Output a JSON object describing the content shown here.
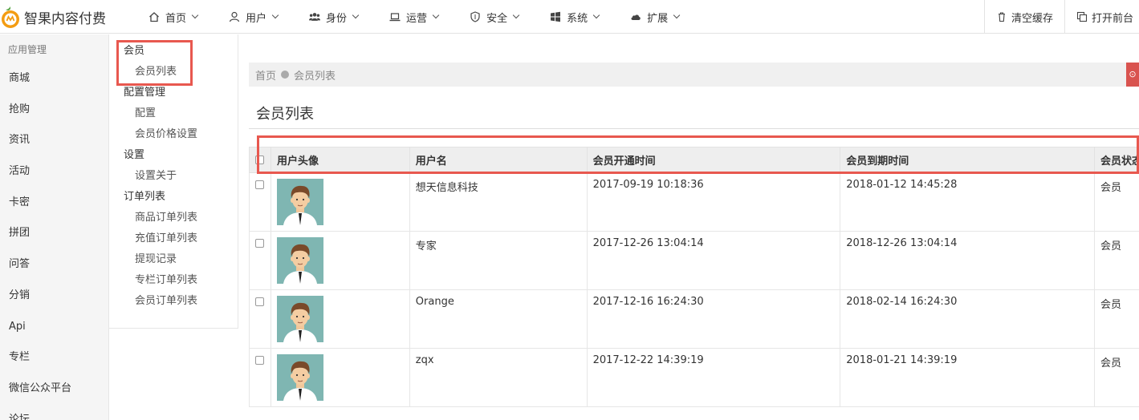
{
  "app": {
    "title": "智果内容付费"
  },
  "nav": [
    {
      "label": "首页",
      "icon": "home-icon"
    },
    {
      "label": "用户",
      "icon": "user-icon"
    },
    {
      "label": "身份",
      "icon": "users-icon"
    },
    {
      "label": "运营",
      "icon": "laptop-icon"
    },
    {
      "label": "安全",
      "icon": "shield-icon"
    },
    {
      "label": "系统",
      "icon": "windows-icon"
    },
    {
      "label": "扩展",
      "icon": "cloud-icon"
    }
  ],
  "nav_right": {
    "clear_cache": "清空缓存",
    "open_frontend": "打开前台"
  },
  "sidebar": {
    "heading": "应用管理",
    "items": [
      "商城",
      "抢购",
      "资讯",
      "活动",
      "卡密",
      "拼团",
      "问答",
      "分销",
      "Api",
      "专栏",
      "微信公众平台",
      "论坛"
    ]
  },
  "submenu": {
    "group_member": "会员",
    "member_list": "会员列表",
    "group_config": "配置管理",
    "config": "配置",
    "member_price": "会员价格设置",
    "group_settings": "设置",
    "settings_about": "设置关于",
    "group_orders": "订单列表",
    "goods_orders": "商品订单列表",
    "recharge_orders": "充值订单列表",
    "withdraw_records": "提现记录",
    "column_orders": "专栏订单列表",
    "member_orders": "会员订单列表"
  },
  "breadcrumb": {
    "home": "首页",
    "current": "会员列表"
  },
  "page_title": "会员列表",
  "table": {
    "headers": [
      "用户头像",
      "用户名",
      "会员开通时间",
      "会员到期时间",
      "会员状态"
    ],
    "rows": [
      {
        "username": "想天信息科技",
        "open_time": "2017-09-19 10:18:36",
        "expire_time": "2018-01-12 14:45:28",
        "status": "会员"
      },
      {
        "username": "专家",
        "open_time": "2017-12-26 13:04:14",
        "expire_time": "2018-12-26 13:04:14",
        "status": "会员"
      },
      {
        "username": "Orange",
        "open_time": "2017-12-16 16:24:30",
        "expire_time": "2018-02-14 16:24:30",
        "status": "会员"
      },
      {
        "username": "zqx",
        "open_time": "2017-12-22 14:39:19",
        "expire_time": "2018-01-21 14:39:19",
        "status": "会员"
      }
    ]
  },
  "colors": {
    "highlight": "#e8584f",
    "orange_logo": "#f39c12",
    "avatar_bg": "#7fb6b2"
  }
}
